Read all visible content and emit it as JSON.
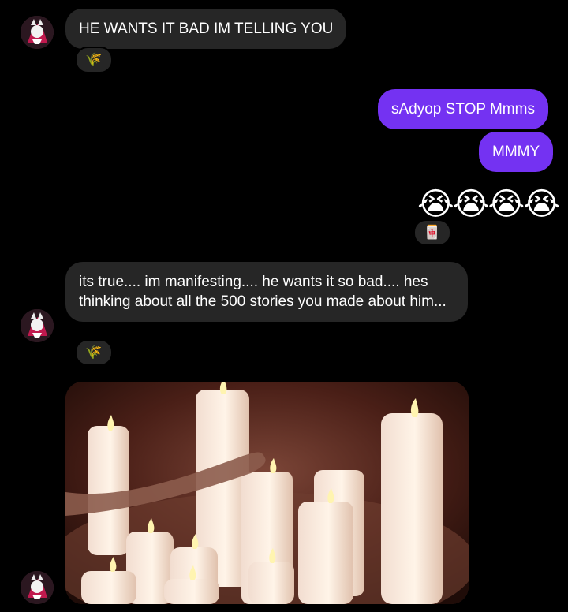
{
  "messages": [
    {
      "text": "HE WANTS IT BAD IM TELLING YOU"
    },
    {
      "text": "sAdyop STOP Mmms"
    },
    {
      "text": "MMMY"
    },
    {
      "text": "😭😭😭😭"
    },
    {
      "text": "its true.... im manifesting.... he wants it so bad.... hes thinking about all the 500 stories you made about him..."
    }
  ],
  "reactions": {
    "first": "🌾",
    "second": "🌾",
    "third": "🀄"
  },
  "image": {
    "alt": "candles"
  },
  "colors": {
    "background": "#000000",
    "incoming": "#262626",
    "outgoing": "#7432f2"
  },
  "icons": {
    "avatar": "profile-avatar-icon",
    "reaction": "grain-reaction-icon"
  }
}
